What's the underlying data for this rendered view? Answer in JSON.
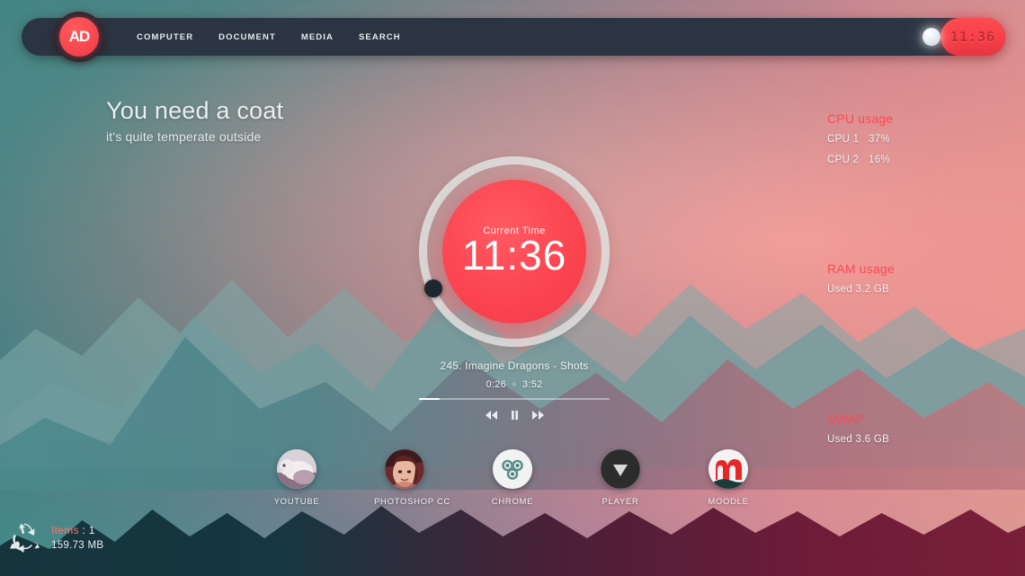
{
  "navbar": {
    "logo_text": "AD",
    "links": [
      {
        "label": "COMPUTER"
      },
      {
        "label": "DOCUMENT"
      },
      {
        "label": "MEDIA"
      },
      {
        "label": "SEARCH"
      }
    ],
    "clock_time": "11:36"
  },
  "greeting": {
    "title": "You need a coat",
    "subtitle": "it's quite temperate outside"
  },
  "stats": {
    "cpu": {
      "title": "CPU usage",
      "rows": [
        {
          "key": "CPU 1",
          "value": "37%"
        },
        {
          "key": "CPU 2",
          "value": "16%"
        }
      ]
    },
    "ram": {
      "title": "RAM usage",
      "used": "Used 3.2 GB"
    },
    "swap": {
      "title": "SWAP",
      "used": "Used 3.6 GB"
    }
  },
  "clock_widget": {
    "label": "Current Time",
    "time": "11:36"
  },
  "player": {
    "track": "245. Imagine Dragons - Shots",
    "elapsed": "0:26",
    "separator": "✧",
    "duration": "3:52",
    "progress_percent": 11
  },
  "dock": [
    {
      "label": "YOUTUBE",
      "icon": "youtube-avatar-icon"
    },
    {
      "label": "PHOTOSHOP CC",
      "icon": "photoshop-avatar-icon"
    },
    {
      "label": "CHROME",
      "icon": "chrome-icon"
    },
    {
      "label": "PLAYER",
      "icon": "player-icon"
    },
    {
      "label": "MOODLE",
      "icon": "moodle-icon"
    }
  ],
  "recycle": {
    "items_label": "Items",
    "items_value": ": 1",
    "size": "159.73 MB"
  },
  "colors": {
    "accent_red": "#fb4a54",
    "navbar": "#2b3442",
    "text_light": "#eef2f3"
  }
}
